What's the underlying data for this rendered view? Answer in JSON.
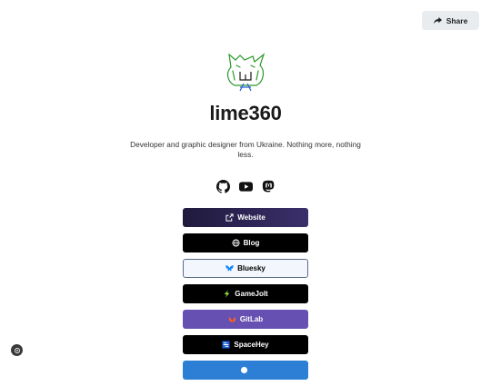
{
  "header": {
    "share_label": "Share"
  },
  "profile": {
    "name": "lime360",
    "bio": "Developer and graphic designer from Ukraine. Nothing more, nothing less."
  },
  "socials": [
    {
      "icon": "github-icon"
    },
    {
      "icon": "youtube-icon"
    },
    {
      "icon": "mastodon-icon"
    }
  ],
  "links": [
    {
      "label": "Website",
      "icon": "external-link-icon",
      "bg": "#2a2450",
      "text": "#ffffff"
    },
    {
      "label": "Blog",
      "icon": "globe-icon",
      "bg": "#000000",
      "text": "#ffffff"
    },
    {
      "label": "Bluesky",
      "icon": "bluesky-icon",
      "bg": "#f3f7fd",
      "text": "#000000",
      "border": "#5a6a86"
    },
    {
      "label": "GameJolt",
      "icon": "gamejolt-icon",
      "bg": "#000000",
      "text": "#ffffff"
    },
    {
      "label": "GitLab",
      "icon": "gitlab-icon",
      "bg": "#6650b2",
      "text": "#ffffff"
    },
    {
      "label": "SpaceHey",
      "icon": "spacehey-icon",
      "bg": "#000000",
      "text": "#ffffff"
    },
    {
      "label": "",
      "icon": "circle-icon",
      "bg": "#2d7fd6",
      "text": "#ffffff"
    }
  ],
  "colors": {
    "accent_website_gradient": [
      "#1f1a3d",
      "#3b2f6b"
    ],
    "page_bg": "#ffffff"
  }
}
